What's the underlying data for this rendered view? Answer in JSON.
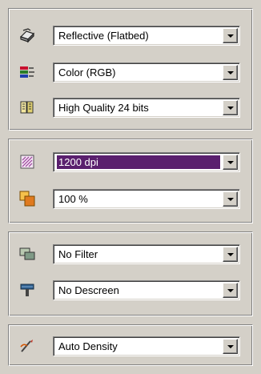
{
  "original_settings": {
    "source_type": {
      "icon": "flatbed-scanner-icon",
      "value": "Reflective (Flatbed)"
    },
    "color_mode": {
      "icon": "color-rgb-icon",
      "value": "Color (RGB)"
    },
    "bit_depth": {
      "icon": "quality-bits-icon",
      "value": "High Quality 24 bits"
    }
  },
  "resolution_settings": {
    "resolution": {
      "icon": "resolution-icon",
      "value": "1200 dpi",
      "selected": true
    },
    "scale": {
      "icon": "scale-percent-icon",
      "value": "100 %"
    }
  },
  "filter_settings": {
    "filter": {
      "icon": "filter-icon",
      "value": "No Filter"
    },
    "descreen": {
      "icon": "descreen-icon",
      "value": "No Descreen"
    }
  },
  "density_settings": {
    "density": {
      "icon": "auto-density-icon",
      "value": "Auto Density"
    }
  },
  "colors": {
    "panel_bg": "#d4d0c8",
    "selection": "#5a1f6e"
  }
}
